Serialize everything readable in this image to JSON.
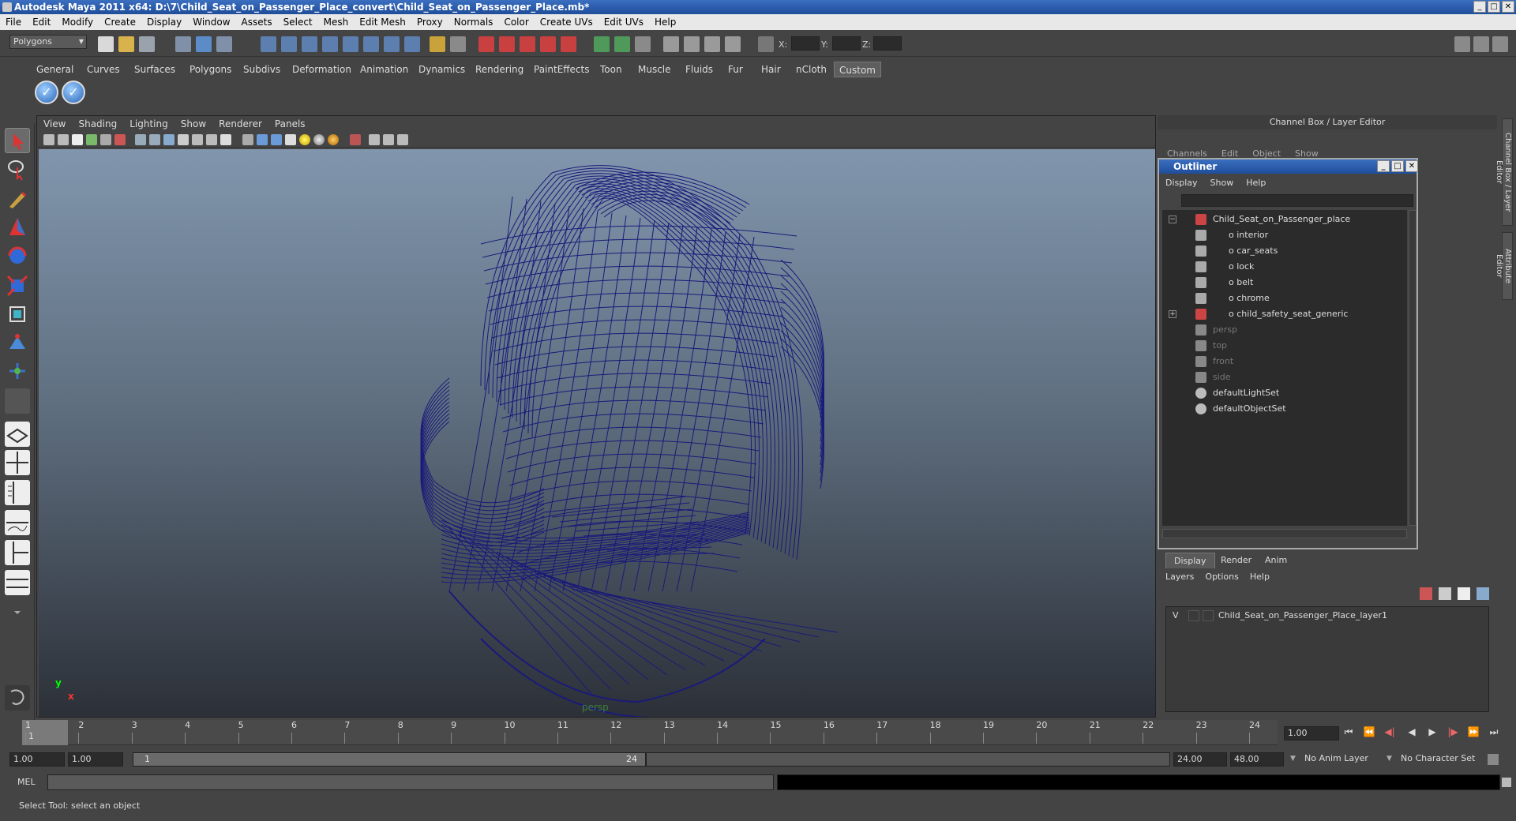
{
  "window": {
    "title": "Autodesk Maya 2011 x64: D:\\7\\Child_Seat_on_Passenger_Place_convert\\Child_Seat_on_Passenger_Place.mb*"
  },
  "menubar": [
    "File",
    "Edit",
    "Modify",
    "Create",
    "Display",
    "Window",
    "Assets",
    "Select",
    "Mesh",
    "Edit Mesh",
    "Proxy",
    "Normals",
    "Color",
    "Create UVs",
    "Edit UVs",
    "Help"
  ],
  "toolbar": {
    "mode": "Polygons",
    "x_label": "X:",
    "y_label": "Y:",
    "z_label": "Z:"
  },
  "shelf": {
    "tabs": [
      "General",
      "Curves",
      "Surfaces",
      "Polygons",
      "Subdivs",
      "Deformation",
      "Animation",
      "Dynamics",
      "Rendering",
      "PaintEffects",
      "Toon",
      "Muscle",
      "Fluids",
      "Fur",
      "Hair",
      "nCloth",
      "Custom"
    ],
    "active_tab": "Custom"
  },
  "viewport": {
    "menu": [
      "View",
      "Shading",
      "Lighting",
      "Show",
      "Renderer",
      "Panels"
    ],
    "camera_label": "persp",
    "axis_y": "y",
    "axis_x": "x",
    "wire_color": "#1a1a7a"
  },
  "channel_box": {
    "title": "Channel Box / Layer Editor",
    "menu": [
      "Channels",
      "Edit",
      "Object",
      "Show"
    ],
    "side_tabs": [
      "Channel Box / Layer Editor",
      "Attribute Editor"
    ]
  },
  "outliner": {
    "title": "Outliner",
    "menu": [
      "Display",
      "Show",
      "Help"
    ],
    "items": [
      {
        "label": "Child_Seat_on_Passenger_place",
        "icon": "transform-icon",
        "expander": "−",
        "dim": false,
        "indent": 0
      },
      {
        "label": "interior",
        "icon": "group-icon",
        "expander": "",
        "dim": false,
        "indent": 1
      },
      {
        "label": "car_seats",
        "icon": "group-icon",
        "expander": "",
        "dim": false,
        "indent": 1
      },
      {
        "label": "lock",
        "icon": "group-icon",
        "expander": "",
        "dim": false,
        "indent": 1
      },
      {
        "label": "belt",
        "icon": "group-icon",
        "expander": "",
        "dim": false,
        "indent": 1
      },
      {
        "label": "chrome",
        "icon": "group-icon",
        "expander": "",
        "dim": false,
        "indent": 1
      },
      {
        "label": "child_safety_seat_generic",
        "icon": "transform-icon",
        "expander": "+",
        "dim": false,
        "indent": 1
      },
      {
        "label": "persp",
        "icon": "camera-icon",
        "expander": "",
        "dim": true,
        "indent": 0
      },
      {
        "label": "top",
        "icon": "camera-icon",
        "expander": "",
        "dim": true,
        "indent": 0
      },
      {
        "label": "front",
        "icon": "camera-icon",
        "expander": "",
        "dim": true,
        "indent": 0
      },
      {
        "label": "side",
        "icon": "camera-icon",
        "expander": "",
        "dim": true,
        "indent": 0
      },
      {
        "label": "defaultLightSet",
        "icon": "set-icon",
        "expander": "",
        "dim": false,
        "indent": 0
      },
      {
        "label": "defaultObjectSet",
        "icon": "set-icon",
        "expander": "",
        "dim": false,
        "indent": 0
      }
    ]
  },
  "layer_editor": {
    "tabs": [
      "Display",
      "Render",
      "Anim"
    ],
    "active_tab": "Display",
    "menu": [
      "Layers",
      "Options",
      "Help"
    ],
    "layer": {
      "visibility": "V",
      "name": "Child_Seat_on_Passenger_Place_layer1"
    }
  },
  "timeline": {
    "ticks": [
      "1",
      "2",
      "3",
      "4",
      "5",
      "6",
      "7",
      "8",
      "9",
      "10",
      "11",
      "12",
      "13",
      "14",
      "15",
      "16",
      "17",
      "18",
      "19",
      "20",
      "21",
      "22",
      "23",
      "24"
    ],
    "current_marker": "1",
    "current_frame": "1.00"
  },
  "range_slider": {
    "start_time": "1.00",
    "playback_start": "1.00",
    "range_start_label": "1",
    "range_end_label": "24",
    "playback_end": "24.00",
    "end_time": "48.00",
    "anim_layer": "No Anim Layer",
    "character_set": "No Character Set"
  },
  "command_line": {
    "label": "MEL"
  },
  "help_line": {
    "text": "Select Tool: select an object"
  }
}
